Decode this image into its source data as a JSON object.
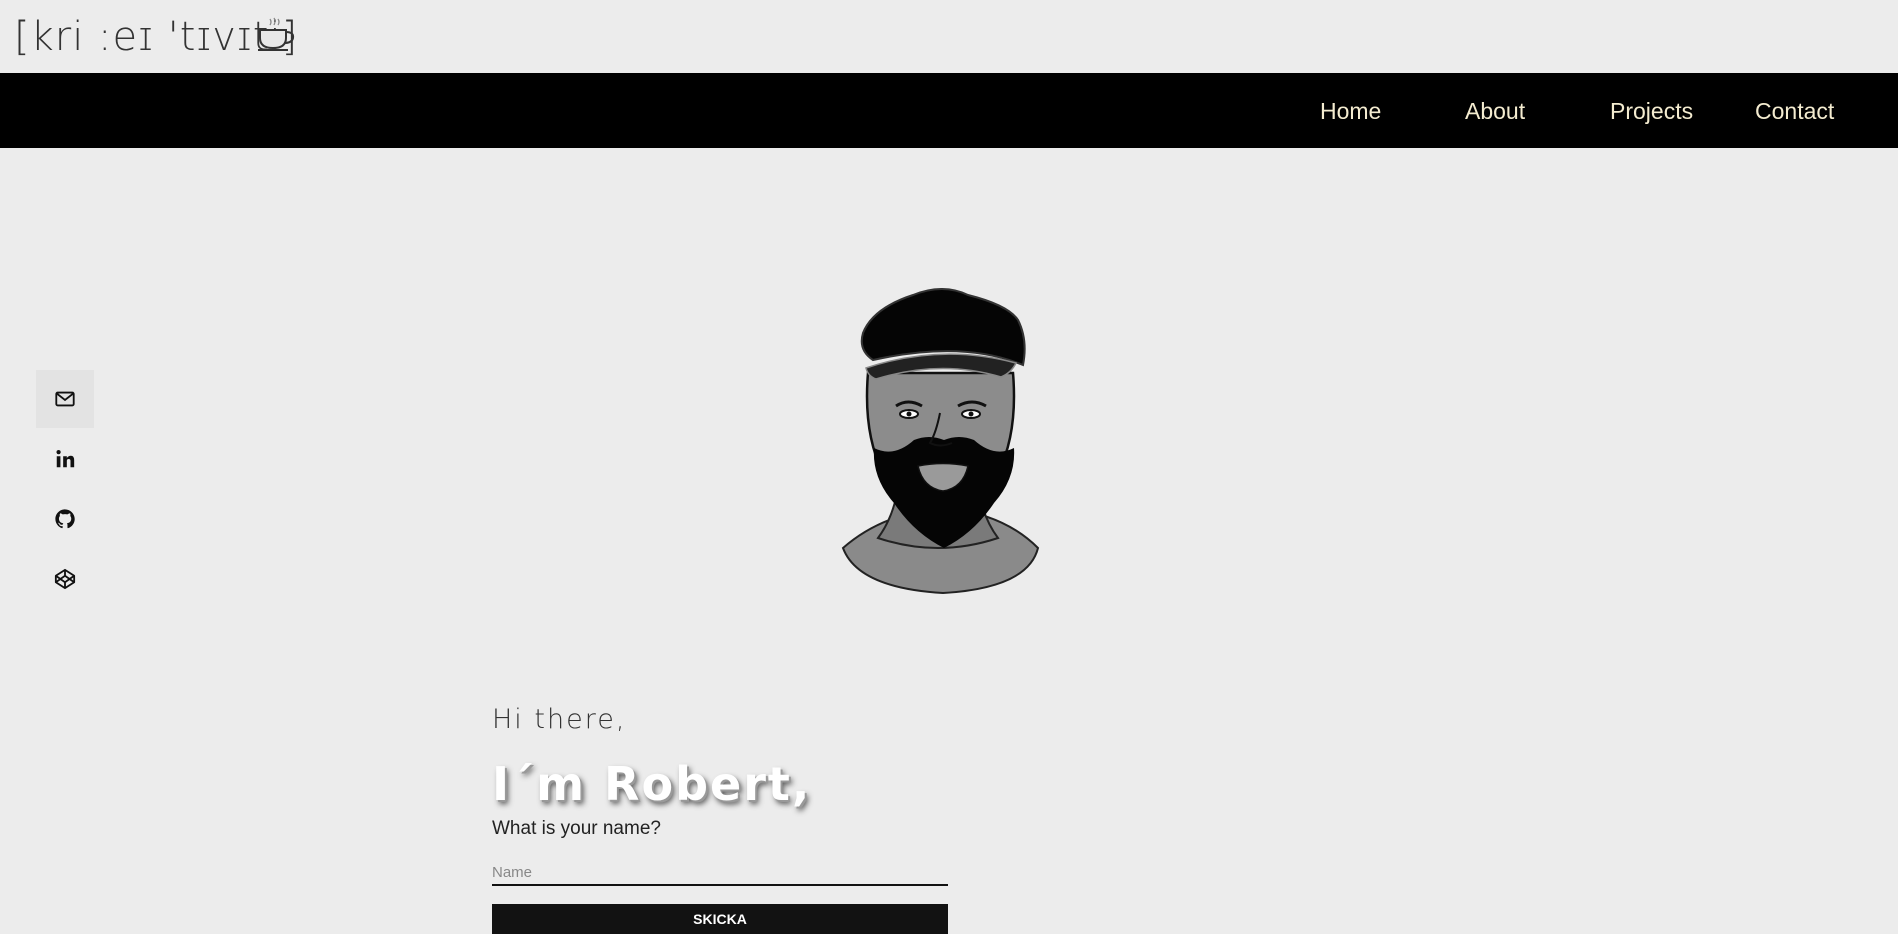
{
  "header": {
    "logo_text": "[kri :eɪ 'tɪvɪti]",
    "logo_icon": "coffee-cup-icon"
  },
  "nav": {
    "items": [
      {
        "label": "Home"
      },
      {
        "label": "About"
      },
      {
        "label": "Projects"
      },
      {
        "label": "Contact"
      }
    ]
  },
  "social": {
    "icons": [
      "mail-icon",
      "linkedin-icon",
      "github-icon",
      "codepen-icon"
    ]
  },
  "hero": {
    "greeting": "Hi there,",
    "name": "I´m Robert,",
    "question": "What is your name?",
    "input_placeholder": "Name",
    "submit_label": "SKICKA"
  },
  "colors": {
    "background": "#ececec",
    "navbar": "#000000",
    "nav_text": "#f4ecd0",
    "button": "#121212"
  }
}
